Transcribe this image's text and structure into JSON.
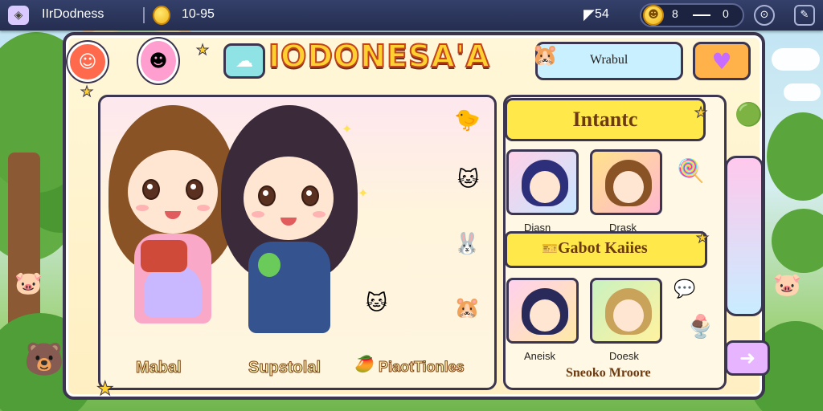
{
  "topbar": {
    "app_title": "IIrDodness",
    "coin_value": "10-95",
    "flag_value": "54",
    "resource_label": "8",
    "resource_value": "0"
  },
  "header": {
    "title": "IODONESA'A",
    "search_text": "Wrabul"
  },
  "stage": {
    "characters": [
      {
        "name": "Mabal"
      },
      {
        "name": "Supstolal"
      }
    ],
    "practice_label": "PiaotTionles"
  },
  "list": {
    "title": "Intantc",
    "cards": [
      {
        "label": "Diasn"
      },
      {
        "label": "Drask"
      },
      {
        "label": "Aneisk"
      },
      {
        "label": "Doesk"
      }
    ],
    "banner": "Gabot Kaiies",
    "footer": "Sneoko Mroore"
  },
  "icons": {
    "app": "app-icon",
    "coin": "coin-icon",
    "flag": "flag-icon",
    "heart": "heart-icon",
    "cloud": "cloud-icon",
    "next": "arrow-right-icon"
  },
  "colors": {
    "panel_border": "#3c3550",
    "title_fill": "#ffd130",
    "title_stroke": "#c2431c",
    "banner": "#ffe94a"
  }
}
